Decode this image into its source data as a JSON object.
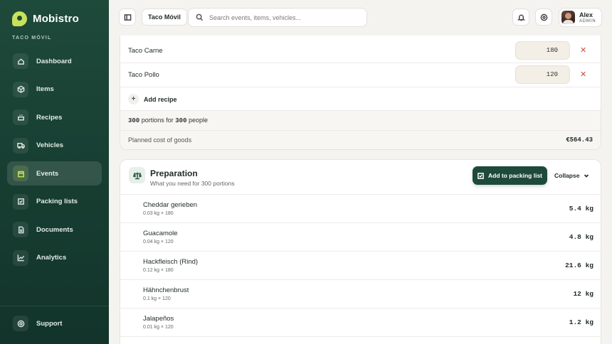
{
  "brand": {
    "name": "Mobistro",
    "tenant": "TACO MÓVIL"
  },
  "nav": {
    "items": [
      {
        "label": "Dashboard",
        "icon": "dashboard-icon"
      },
      {
        "label": "Items",
        "icon": "box-icon"
      },
      {
        "label": "Recipes",
        "icon": "pot-icon"
      },
      {
        "label": "Vehicles",
        "icon": "truck-icon"
      },
      {
        "label": "Events",
        "icon": "calendar-icon",
        "active": true
      },
      {
        "label": "Packing lists",
        "icon": "checklist-icon"
      },
      {
        "label": "Documents",
        "icon": "document-icon"
      },
      {
        "label": "Analytics",
        "icon": "chart-icon"
      }
    ],
    "support": "Support"
  },
  "topbar": {
    "breadcrumb": "Taco Móvil",
    "search_placeholder": "Search events, items, vehicles...",
    "user": {
      "name": "Alex",
      "role": "ADMIN"
    }
  },
  "recipes": {
    "rows": [
      {
        "name": "Taco Carne",
        "qty": "180"
      },
      {
        "name": "Taco Pollo",
        "qty": "120"
      }
    ],
    "add_label": "Add recipe",
    "portions": "300",
    "portions_text": "portions for",
    "people": "300",
    "people_text": "people",
    "cost_label": "Planned cost of goods",
    "cost_value": "€564.43"
  },
  "preparation": {
    "title": "Preparation",
    "subtitle": "What you need for 300 portions",
    "pack_button": "Add to packing list",
    "collapse": "Collapse",
    "items": [
      {
        "name": "Cheddar gerieben",
        "calc": "0.03 kg × 180",
        "total": "5.4 kg"
      },
      {
        "name": "Guacamole",
        "calc": "0.04 kg × 120",
        "total": "4.8 kg"
      },
      {
        "name": "Hackfleisch (Rind)",
        "calc": "0.12 kg × 180",
        "total": "21.6 kg"
      },
      {
        "name": "Hähnchenbrust",
        "calc": "0.1 kg × 120",
        "total": "12 kg"
      },
      {
        "name": "Jalapeños",
        "calc": "0.01 kg × 120",
        "total": "1.2 kg"
      }
    ]
  },
  "colors": {
    "sidebar": "#1e4a3b",
    "accent": "#c8e35a",
    "danger": "#c94a3a"
  }
}
